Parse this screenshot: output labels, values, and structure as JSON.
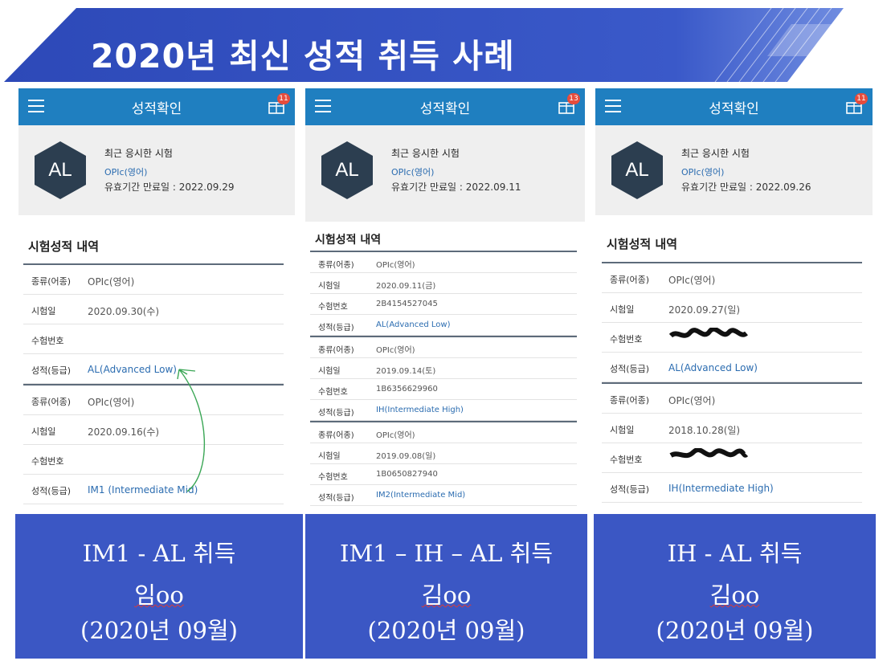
{
  "banner": {
    "title": "2020년 최신 성적 취득 사례"
  },
  "panels": [
    {
      "appbar_title": "성적확인",
      "badge": "11",
      "avatar": "AL",
      "recent_label": "최근 응시한 시험",
      "exam_name": "OPIc(영어)",
      "expiry": "유효기간 만료일 : 2022.09.29",
      "section_title": "시험성적 내역",
      "groups": [
        {
          "rows": [
            {
              "k": "종류(어종)",
              "v": "OPIc(영어)"
            },
            {
              "k": "시험일",
              "v": "2020.09.30(수)"
            },
            {
              "k": "수험번호",
              "v": ""
            },
            {
              "k": "성적(등급)",
              "v": "AL(Advanced Low)"
            }
          ]
        },
        {
          "rows": [
            {
              "k": "종류(어종)",
              "v": "OPIc(영어)"
            },
            {
              "k": "시험일",
              "v": "2020.09.16(수)"
            },
            {
              "k": "수험번호",
              "v": ""
            },
            {
              "k": "성적(등급)",
              "v": "IM1 (Intermediate Mid)"
            }
          ]
        }
      ]
    },
    {
      "appbar_title": "성적확인",
      "badge": "13",
      "avatar": "AL",
      "recent_label": "최근 응시한 시험",
      "exam_name": "OPIc(영어)",
      "expiry": "유효기간 만료일 : 2022.09.11",
      "section_title": "시험성적 내역",
      "groups": [
        {
          "rows": [
            {
              "k": "종류(어종)",
              "v": "OPIc(영어)"
            },
            {
              "k": "시험일",
              "v": "2020.09.11(금)"
            },
            {
              "k": "수험번호",
              "v": "2B4154527045"
            },
            {
              "k": "성적(등급)",
              "v": "AL(Advanced Low)"
            }
          ]
        },
        {
          "rows": [
            {
              "k": "종류(어종)",
              "v": "OPIc(영어)"
            },
            {
              "k": "시험일",
              "v": "2019.09.14(토)"
            },
            {
              "k": "수험번호",
              "v": "1B6356629960"
            },
            {
              "k": "성적(등급)",
              "v": "IH(Intermediate High)"
            }
          ]
        },
        {
          "rows": [
            {
              "k": "종류(어종)",
              "v": "OPIc(영어)"
            },
            {
              "k": "시험일",
              "v": "2019.09.08(일)"
            },
            {
              "k": "수험번호",
              "v": "1B0650827940"
            },
            {
              "k": "성적(등급)",
              "v": "IM2(Intermediate Mid)"
            }
          ]
        }
      ]
    },
    {
      "appbar_title": "성적확인",
      "badge": "11",
      "avatar": "AL",
      "recent_label": "최근 응시한 시험",
      "exam_name": "OPIc(영어)",
      "expiry": "유효기간 만료일 : 2022.09.26",
      "section_title": "시험성적 내역",
      "groups": [
        {
          "rows": [
            {
              "k": "종류(어종)",
              "v": "OPIc(영어)"
            },
            {
              "k": "시험일",
              "v": "2020.09.27(일)"
            },
            {
              "k": "수험번호",
              "v": ""
            },
            {
              "k": "성적(등급)",
              "v": "AL(Advanced Low)"
            }
          ]
        },
        {
          "rows": [
            {
              "k": "종류(어종)",
              "v": "OPIc(영어)"
            },
            {
              "k": "시험일",
              "v": "2018.10.28(일)"
            },
            {
              "k": "수험번호",
              "v": ""
            },
            {
              "k": "성적(등급)",
              "v": "IH(Intermediate High)"
            }
          ]
        }
      ]
    }
  ],
  "captions": [
    {
      "line1": "IM1 - AL 취득",
      "name": "임oo",
      "date": "(2020년 09월)"
    },
    {
      "line1": "IM1 – IH – AL 취득",
      "name": "김oo",
      "date": "(2020년 09월)"
    },
    {
      "line1": "IH - AL 취득",
      "name": "김oo",
      "date": "(2020년 09월)"
    }
  ],
  "colors": {
    "banner": "#3a55c6",
    "appbar": "#1f7fc0",
    "caption": "#3b57c4",
    "hex": "#2c3e50",
    "grade": "#2b6cb0"
  }
}
